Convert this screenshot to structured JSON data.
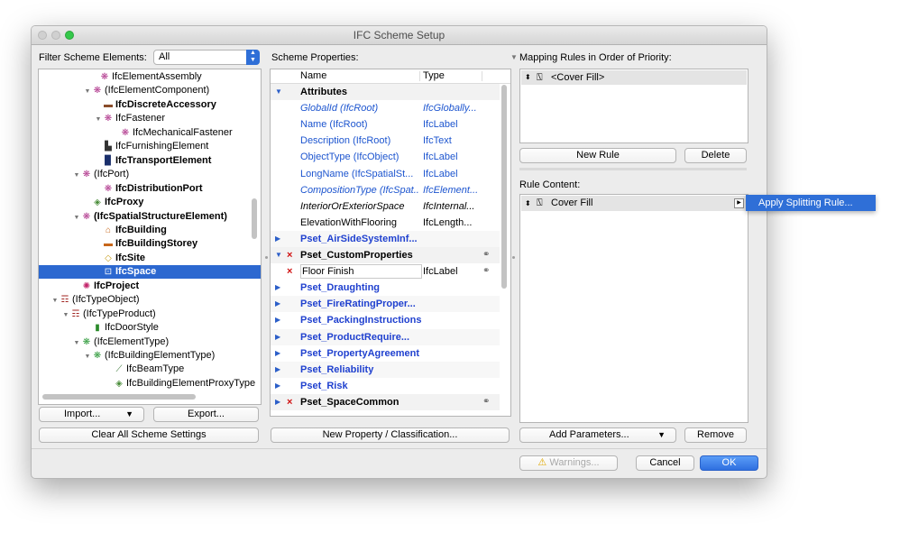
{
  "window": {
    "title": "IFC Scheme Setup"
  },
  "left": {
    "filter_label": "Filter Scheme Elements:",
    "filter_value": "All",
    "tree": [
      {
        "label": "IfcElementAssembly",
        "bold": false,
        "icon": "assembly-icon",
        "glyph": "❋",
        "color": "#b0368c",
        "tri": ""
      },
      {
        "label": "(IfcElementComponent)",
        "bold": false,
        "icon": "assembly-icon",
        "glyph": "❋",
        "color": "#b0368c",
        "tri": "▼"
      },
      {
        "label": "IfcDiscreteAccessory",
        "bold": true,
        "icon": "accessory-icon",
        "glyph": "▬",
        "color": "#8a4d2a",
        "tri": ""
      },
      {
        "label": "IfcFastener",
        "bold": false,
        "icon": "assembly-icon",
        "glyph": "❋",
        "color": "#b0368c",
        "tri": "▼"
      },
      {
        "label": "IfcMechanicalFastener",
        "bold": false,
        "icon": "assembly-icon",
        "glyph": "❋",
        "color": "#b0368c",
        "tri": ""
      },
      {
        "label": "IfcFurnishingElement",
        "bold": false,
        "icon": "furniture-icon",
        "glyph": "▙",
        "color": "#333333",
        "tri": ""
      },
      {
        "label": "IfcTransportElement",
        "bold": true,
        "icon": "transport-icon",
        "glyph": "▉",
        "color": "#1a2f6b",
        "tri": ""
      },
      {
        "label": "(IfcPort)",
        "bold": false,
        "icon": "assembly-icon",
        "glyph": "❋",
        "color": "#b0368c",
        "tri": "▼"
      },
      {
        "label": "IfcDistributionPort",
        "bold": true,
        "icon": "assembly-icon",
        "glyph": "❋",
        "color": "#b0368c",
        "tri": ""
      },
      {
        "label": "IfcProxy",
        "bold": true,
        "icon": "proxy-icon",
        "glyph": "◈",
        "color": "#4a8d3a",
        "tri": ""
      },
      {
        "label": "(IfcSpatialStructureElement)",
        "bold": true,
        "icon": "assembly-icon",
        "glyph": "❋",
        "color": "#b0368c",
        "tri": "▼"
      },
      {
        "label": "IfcBuilding",
        "bold": true,
        "icon": "building-icon",
        "glyph": "⌂",
        "color": "#c7661a",
        "tri": ""
      },
      {
        "label": "IfcBuildingStorey",
        "bold": true,
        "icon": "storey-icon",
        "glyph": "▬",
        "color": "#c7661a",
        "tri": ""
      },
      {
        "label": "IfcSite",
        "bold": true,
        "icon": "site-icon",
        "glyph": "◇",
        "color": "#c9a01f",
        "tri": ""
      },
      {
        "label": "IfcSpace",
        "bold": true,
        "icon": "space-icon",
        "glyph": "⊡",
        "color": "#ffffff",
        "tri": ""
      },
      {
        "label": "IfcProject",
        "bold": true,
        "icon": "project-icon",
        "glyph": "✺",
        "color": "#c2246a",
        "tri": ""
      },
      {
        "label": "(IfcTypeObject)",
        "bold": false,
        "icon": "type-object-icon",
        "glyph": "☶",
        "color": "#a0231f",
        "tri": "▼"
      },
      {
        "label": "(IfcTypeProduct)",
        "bold": false,
        "icon": "type-object-icon",
        "glyph": "☶",
        "color": "#a0231f",
        "tri": "▼"
      },
      {
        "label": "IfcDoorStyle",
        "bold": false,
        "icon": "door-icon",
        "glyph": "▮",
        "color": "#2a8a2a",
        "tri": ""
      },
      {
        "label": "(IfcElementType)",
        "bold": false,
        "icon": "element-type-icon",
        "glyph": "❋",
        "color": "#2e9a3a",
        "tri": "▼"
      },
      {
        "label": "(IfcBuildingElementType)",
        "bold": false,
        "icon": "element-type-icon",
        "glyph": "❋",
        "color": "#2e9a3a",
        "tri": "▼"
      },
      {
        "label": "IfcBeamType",
        "bold": false,
        "icon": "beam-icon",
        "glyph": "⟋",
        "color": "#3e7a3a",
        "tri": ""
      },
      {
        "label": "IfcBuildingElementProxyType",
        "bold": false,
        "icon": "proxy-type-icon",
        "glyph": "◈",
        "color": "#4a8d3a",
        "tri": ""
      }
    ],
    "import_label": "Import...",
    "export_label": "Export...",
    "clear_label": "Clear All Scheme Settings"
  },
  "middle": {
    "header": "Scheme Properties:",
    "col_name": "Name",
    "col_type": "Type",
    "rows": [
      {
        "name": "Attributes",
        "type": "",
        "kind": "group",
        "tri": "▼",
        "x": false,
        "link": false
      },
      {
        "name": "GlobalId (IfcRoot)",
        "type": "IfcGlobally...",
        "kind": "attr-italic",
        "tri": "",
        "x": false,
        "link": false
      },
      {
        "name": "Name (IfcRoot)",
        "type": "IfcLabel",
        "kind": "attr",
        "tri": "",
        "x": false,
        "link": false
      },
      {
        "name": "Description (IfcRoot)",
        "type": "IfcText",
        "kind": "attr",
        "tri": "",
        "x": false,
        "link": false
      },
      {
        "name": "ObjectType (IfcObject)",
        "type": "IfcLabel",
        "kind": "attr",
        "tri": "",
        "x": false,
        "link": false
      },
      {
        "name": "LongName (IfcSpatialSt...",
        "type": "IfcLabel",
        "kind": "attr",
        "tri": "",
        "x": false,
        "link": false
      },
      {
        "name": "CompositionType (IfcSpat...",
        "type": "IfcElement...",
        "kind": "attr-italic",
        "tri": "",
        "x": false,
        "link": false
      },
      {
        "name": "InteriorOrExteriorSpace",
        "type": "IfcInternal...",
        "kind": "black-italic",
        "tri": "",
        "x": false,
        "link": false
      },
      {
        "name": "ElevationWithFlooring",
        "type": "IfcLength...",
        "kind": "black",
        "tri": "",
        "x": false,
        "link": false
      },
      {
        "name": "Pset_AirSideSystemInf...",
        "type": "",
        "kind": "pset",
        "tri": "▶",
        "x": false,
        "link": false
      },
      {
        "name": "Pset_CustomProperties",
        "type": "",
        "kind": "group",
        "tri": "▼",
        "x": true,
        "link": true
      },
      {
        "name": "Floor Finish",
        "type": "IfcLabel",
        "kind": "black",
        "tri": "",
        "x": true,
        "link": true
      },
      {
        "name": "Pset_Draughting",
        "type": "",
        "kind": "pset",
        "tri": "▶",
        "x": false,
        "link": false
      },
      {
        "name": "Pset_FireRatingProper...",
        "type": "",
        "kind": "pset",
        "tri": "▶",
        "x": false,
        "link": false
      },
      {
        "name": "Pset_PackingInstructions",
        "type": "",
        "kind": "pset",
        "tri": "▶",
        "x": false,
        "link": false
      },
      {
        "name": "Pset_ProductRequire...",
        "type": "",
        "kind": "pset",
        "tri": "▶",
        "x": false,
        "link": false
      },
      {
        "name": "Pset_PropertyAgreement",
        "type": "",
        "kind": "pset",
        "tri": "▶",
        "x": false,
        "link": false
      },
      {
        "name": "Pset_Reliability",
        "type": "",
        "kind": "pset",
        "tri": "▶",
        "x": false,
        "link": false
      },
      {
        "name": "Pset_Risk",
        "type": "",
        "kind": "pset",
        "tri": "▶",
        "x": false,
        "link": false
      },
      {
        "name": "Pset_SpaceCommon",
        "type": "",
        "kind": "group",
        "tri": "▶",
        "x": true,
        "link": true
      }
    ],
    "new_property_label": "New Property / Classification..."
  },
  "right": {
    "mapping_header": "Mapping Rules in Order of Priority:",
    "mapping_item": "<Cover Fill>",
    "new_rule_label": "New Rule",
    "delete_label": "Delete",
    "rule_content_header": "Rule Content:",
    "rule_item": "Cover Fill",
    "add_params_label": "Add Parameters...",
    "remove_label": "Remove"
  },
  "popup": {
    "apply_splitting": "Apply Splitting Rule..."
  },
  "footer": {
    "warnings_label": "Warnings...",
    "cancel_label": "Cancel",
    "ok_label": "OK"
  }
}
